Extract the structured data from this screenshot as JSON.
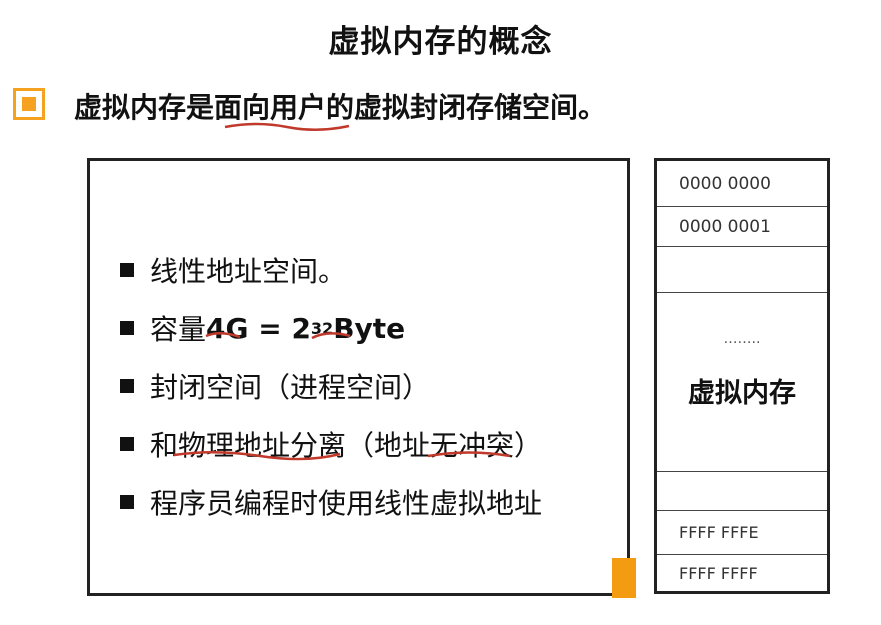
{
  "title": "虚拟内存的概念",
  "subtitle": "虚拟内存是面向用户的虚拟封闭存储空间。",
  "bullets": [
    {
      "text": "线性地址空间。"
    },
    {
      "prefix": "容量",
      "bold": "4G = 2",
      "sup": "32",
      "suffix": " Byte"
    },
    {
      "text": "封闭空间（进程空间）"
    },
    {
      "text": "和物理地址分离（地址无冲突）"
    },
    {
      "text": "程序员编程时使用线性虚拟地址"
    }
  ],
  "memory": {
    "addr_top_0": "0000 0000",
    "addr_top_1": "0000 0001",
    "ellipsis": "……..",
    "label": "虚拟内存",
    "addr_bottom_0": "FFFF FFFE",
    "addr_bottom_1": "FFFF FFFF"
  },
  "colors": {
    "accent": "#f39c12",
    "annotation": "#c0392b"
  }
}
